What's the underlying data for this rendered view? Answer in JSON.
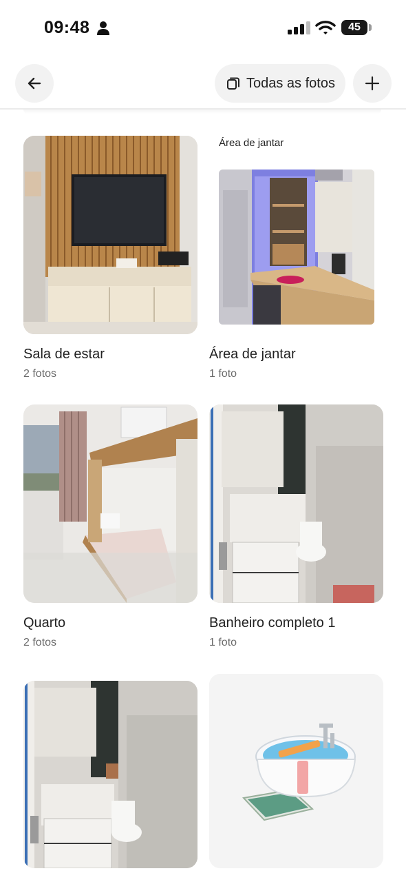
{
  "status_bar": {
    "time": "09:48",
    "battery": "45",
    "icons": [
      "person-icon",
      "signal-icon",
      "wifi-icon",
      "battery-icon"
    ]
  },
  "header": {
    "back_icon": "arrow-left-icon",
    "all_photos_label": "Todas as fotos",
    "all_photos_icon": "copy-icon",
    "add_icon": "plus-icon"
  },
  "rooms": [
    {
      "title": "Sala de estar",
      "count": "2 fotos"
    },
    {
      "title": "Área de jantar",
      "count": "1 foto",
      "overlay_caption": "Área de jantar"
    },
    {
      "title": "Quarto",
      "count": "2 fotos"
    },
    {
      "title": "Banheiro completo 1",
      "count": "1 foto"
    },
    {
      "title": "",
      "count": ""
    },
    {
      "title": "",
      "count": ""
    }
  ],
  "colors": {
    "button_bg": "#f2f2f2",
    "text_primary": "#222222",
    "text_secondary": "#6a6a6a"
  }
}
